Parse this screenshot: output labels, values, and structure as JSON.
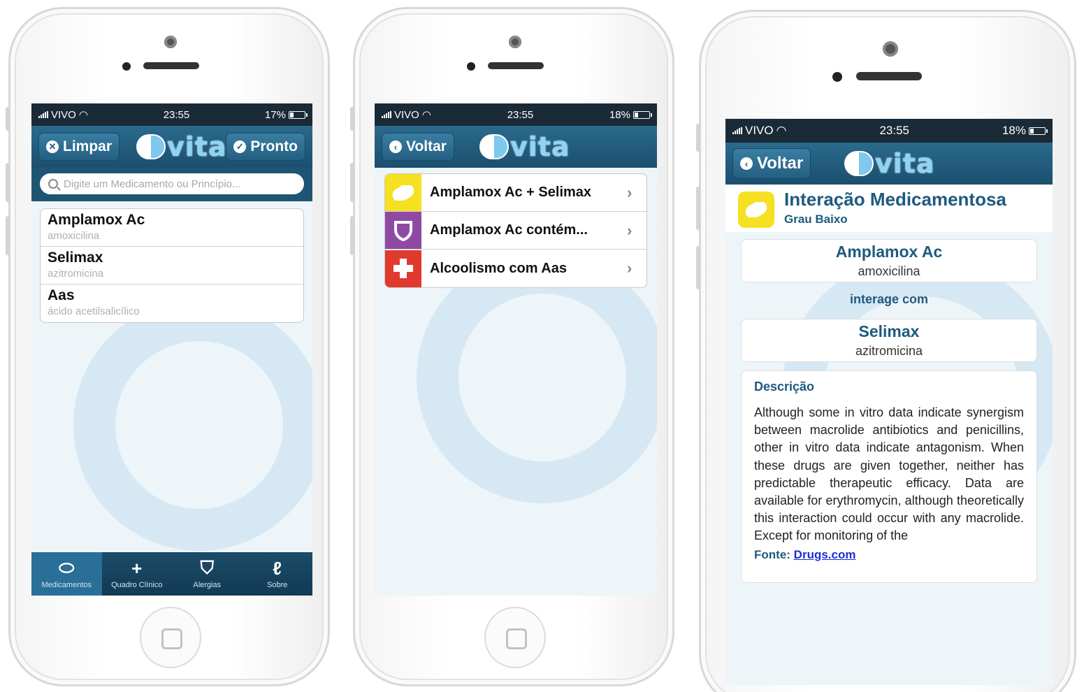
{
  "status_bar": {
    "carrier": "VIVO",
    "time": "23:55",
    "battery_1": "17%",
    "battery_2": "18%",
    "battery_3": "18%"
  },
  "brand": {
    "logo_text": "vita"
  },
  "screen1": {
    "left_button": "Limpar",
    "right_button": "Pronto",
    "search_placeholder": "Digite um Medicamento ou Princípio...",
    "items": [
      {
        "name": "Amplamox Ac",
        "generic": "amoxicilina"
      },
      {
        "name": "Selimax",
        "generic": "azitromicina"
      },
      {
        "name": "Aas",
        "generic": "ácido acetilsalicílico"
      }
    ],
    "tabs": [
      {
        "label": "Medicamentos",
        "icon": "pill-icon"
      },
      {
        "label": "Quadro Clínico",
        "icon": "plus-icon"
      },
      {
        "label": "Alergias",
        "icon": "shield-icon"
      },
      {
        "label": "Sobre",
        "icon": "logo-icon"
      }
    ]
  },
  "screen2": {
    "back_button": "Voltar",
    "items": [
      {
        "label": "Amplamox Ac + Selimax",
        "icon": "pill-icon",
        "color": "#f5e021"
      },
      {
        "label": "Amplamox Ac contém...",
        "icon": "shield-icon",
        "color": "#8e4aa3"
      },
      {
        "label": "Alcoolismo com Aas",
        "icon": "cross-icon",
        "color": "#e03a2f"
      }
    ]
  },
  "screen3": {
    "back_button": "Voltar",
    "title": "Interação Medicamentosa",
    "severity": "Grau Baixo",
    "drug1": {
      "name": "Amplamox Ac",
      "generic": "amoxicilina"
    },
    "connector": "interage com",
    "drug2": {
      "name": "Selimax",
      "generic": "azitromicina"
    },
    "description_title": "Descrição",
    "description": "Although some in vitro data indicate synergism between macrolide antibiotics and penicillins, other in vitro data indicate antagonism. When these drugs are given together, neither has predictable therapeutic efficacy. Data are available for erythromycin, although theoretically this interaction could occur with any macrolide. Except for monitoring of the",
    "source_label": "Fonte:",
    "source_link": "Drugs.com"
  },
  "colors": {
    "navbar": "#1b4f6e",
    "accent_text": "#1f5a7e",
    "pill_yellow": "#f5e021",
    "shield_purple": "#8e4aa3",
    "cross_red": "#e03a2f",
    "link": "#1a2fd6"
  }
}
